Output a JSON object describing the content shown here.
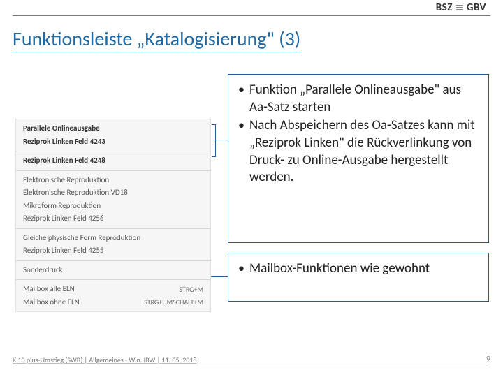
{
  "logo": {
    "bsz": "BSZ",
    "gbv": "GBV"
  },
  "title": "Funktionsleiste „Katalogisierung\" (3)",
  "menu": {
    "groups": [
      {
        "rows": [
          {
            "label": "Parallele Onlineausgabe",
            "bold": true,
            "shortcut": ""
          },
          {
            "label": "Reziprok Linken Feld 4243",
            "bold": true,
            "shortcut": ""
          }
        ]
      },
      {
        "rows": [
          {
            "label": "Reziprok Linken Feld 4248",
            "bold": true,
            "shortcut": ""
          }
        ]
      },
      {
        "rows": [
          {
            "label": "Elektronische Reproduktion",
            "bold": false,
            "shortcut": ""
          },
          {
            "label": "Elektronische Reproduktion VD18",
            "bold": false,
            "shortcut": ""
          },
          {
            "label": "Mikroform Reproduktion",
            "bold": false,
            "shortcut": ""
          },
          {
            "label": "Reziprok Linken Feld 4256",
            "bold": false,
            "shortcut": ""
          }
        ]
      },
      {
        "rows": [
          {
            "label": "Gleiche physische Form Reproduktion",
            "bold": false,
            "shortcut": ""
          },
          {
            "label": "Reziprok Linken Feld 4255",
            "bold": false,
            "shortcut": ""
          }
        ]
      },
      {
        "rows": [
          {
            "label": "Sonderdruck",
            "bold": false,
            "shortcut": ""
          }
        ]
      },
      {
        "rows": [
          {
            "label": "Mailbox alle ELN",
            "bold": false,
            "shortcut": "STRG+M"
          },
          {
            "label": "Mailbox ohne ELN",
            "bold": false,
            "shortcut": "STRG+UMSCHALT+M"
          }
        ]
      }
    ]
  },
  "callout1": {
    "items": [
      "Funktion „Parallele Onlineausgabe\" aus Aa-Satz starten",
      "Nach Abspeichern des Oa-Satzes kann mit „Reziprok Linken\" die Rückverlinkung von Druck- zu Online-Ausgabe hergestellt werden."
    ]
  },
  "callout2": {
    "items": [
      "Mailbox-Funktionen wie gewohnt"
    ]
  },
  "footer": {
    "left": "K 10 plus-Umstieg (SWB) | Allgemeines - Win. IBW | 11. 05. 2018",
    "page": "9"
  }
}
